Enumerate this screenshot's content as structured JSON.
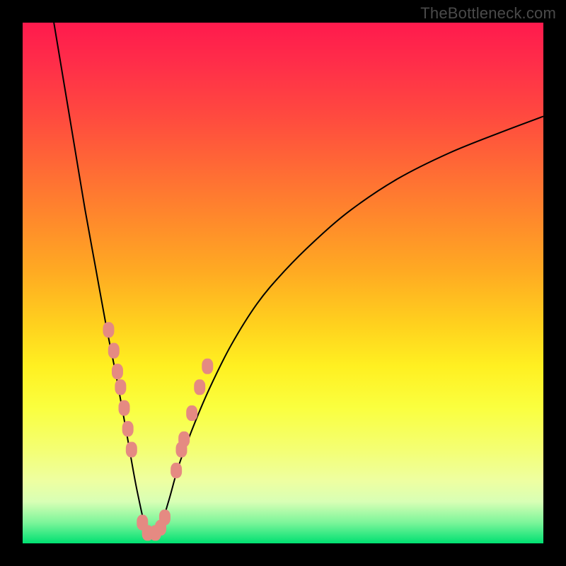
{
  "watermark": "TheBottleneck.com",
  "colors": {
    "frame": "#000000",
    "curve": "#000000",
    "marker": "#e58a82",
    "gradient_top": "#ff1a4d",
    "gradient_bottom": "#00e072"
  },
  "chart_data": {
    "type": "line",
    "title": "",
    "xlabel": "",
    "ylabel": "",
    "xlim": [
      0,
      100
    ],
    "ylim": [
      0,
      100
    ],
    "legend": false,
    "grid": false,
    "series": [
      {
        "name": "bottleneck-curve",
        "description": "V-shaped curve; minimum (best match) near x≈24, right arm rises asymptotically",
        "x": [
          6,
          8,
          10,
          12,
          14,
          16,
          18,
          20,
          22,
          24,
          26,
          28,
          30,
          33,
          36,
          40,
          45,
          50,
          56,
          63,
          72,
          82,
          92,
          100
        ],
        "y": [
          100,
          88,
          76,
          64,
          53,
          42,
          32,
          21,
          10,
          2,
          2,
          8,
          15,
          23,
          30,
          38,
          46,
          52,
          58,
          64,
          70,
          75,
          79,
          82
        ]
      }
    ],
    "markers": {
      "name": "observed-points",
      "shape": "rounded-rect",
      "color": "#e58a82",
      "points": [
        {
          "x": 16.5,
          "y": 41
        },
        {
          "x": 17.5,
          "y": 37
        },
        {
          "x": 18.2,
          "y": 33
        },
        {
          "x": 18.8,
          "y": 30
        },
        {
          "x": 19.5,
          "y": 26
        },
        {
          "x": 20.2,
          "y": 22
        },
        {
          "x": 20.9,
          "y": 18
        },
        {
          "x": 23.0,
          "y": 4
        },
        {
          "x": 24.0,
          "y": 2
        },
        {
          "x": 25.5,
          "y": 2
        },
        {
          "x": 26.5,
          "y": 3
        },
        {
          "x": 27.3,
          "y": 5
        },
        {
          "x": 29.5,
          "y": 14
        },
        {
          "x": 30.5,
          "y": 18
        },
        {
          "x": 31.0,
          "y": 20
        },
        {
          "x": 32.5,
          "y": 25
        },
        {
          "x": 34.0,
          "y": 30
        },
        {
          "x": 35.5,
          "y": 34
        }
      ]
    }
  }
}
